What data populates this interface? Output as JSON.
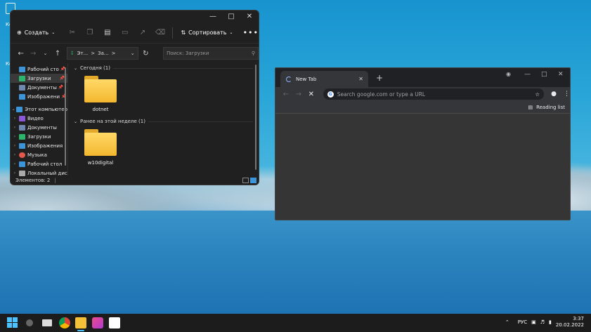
{
  "desktop": {
    "labels": [
      "Ко",
      "Ко"
    ]
  },
  "explorer": {
    "toolbar": {
      "new_label": "Создать",
      "sort_label": "Сортировать",
      "more_label": "•••"
    },
    "address": {
      "segments": [
        "Эт...",
        ">",
        "За...",
        ">"
      ]
    },
    "search": {
      "placeholder": "Поиск: Загрузки"
    },
    "nav": {
      "quick": [
        {
          "label": "Рабочий сто",
          "color": "#3b95d8",
          "pinned": true
        },
        {
          "label": "Загрузки",
          "color": "#2bb56c",
          "pinned": true,
          "selected": true
        },
        {
          "label": "Документы",
          "color": "#6f88b0",
          "pinned": true
        },
        {
          "label": "Изображени",
          "color": "#3b95d8",
          "pinned": true
        }
      ],
      "pc_label": "Этот компьютер",
      "pc_items": [
        {
          "label": "Видео",
          "color": "#8a58d6"
        },
        {
          "label": "Документы",
          "color": "#6f88b0"
        },
        {
          "label": "Загрузки",
          "color": "#2bb56c"
        },
        {
          "label": "Изображения",
          "color": "#3b95d8"
        },
        {
          "label": "Музыка",
          "color": "#e3584a"
        },
        {
          "label": "Рабочий стол",
          "color": "#3b95d8"
        },
        {
          "label": "Локальный дис",
          "color": "#aaaaaa"
        }
      ]
    },
    "groups": [
      {
        "label": "Сегодня (1)",
        "folders": [
          "dotnet"
        ]
      },
      {
        "label": "Ранее на этой неделе (1)",
        "folders": [
          "w10digital"
        ]
      }
    ],
    "status": {
      "count": "Элементов: 2",
      "sep": "|"
    }
  },
  "chrome": {
    "tab_title": "New Tab",
    "omnibox_placeholder": "Search google.com or type a URL",
    "reading_list": "Reading list"
  },
  "taskbar": {
    "lang": "РУС",
    "time": "3:37",
    "date": "20.02.2022"
  }
}
